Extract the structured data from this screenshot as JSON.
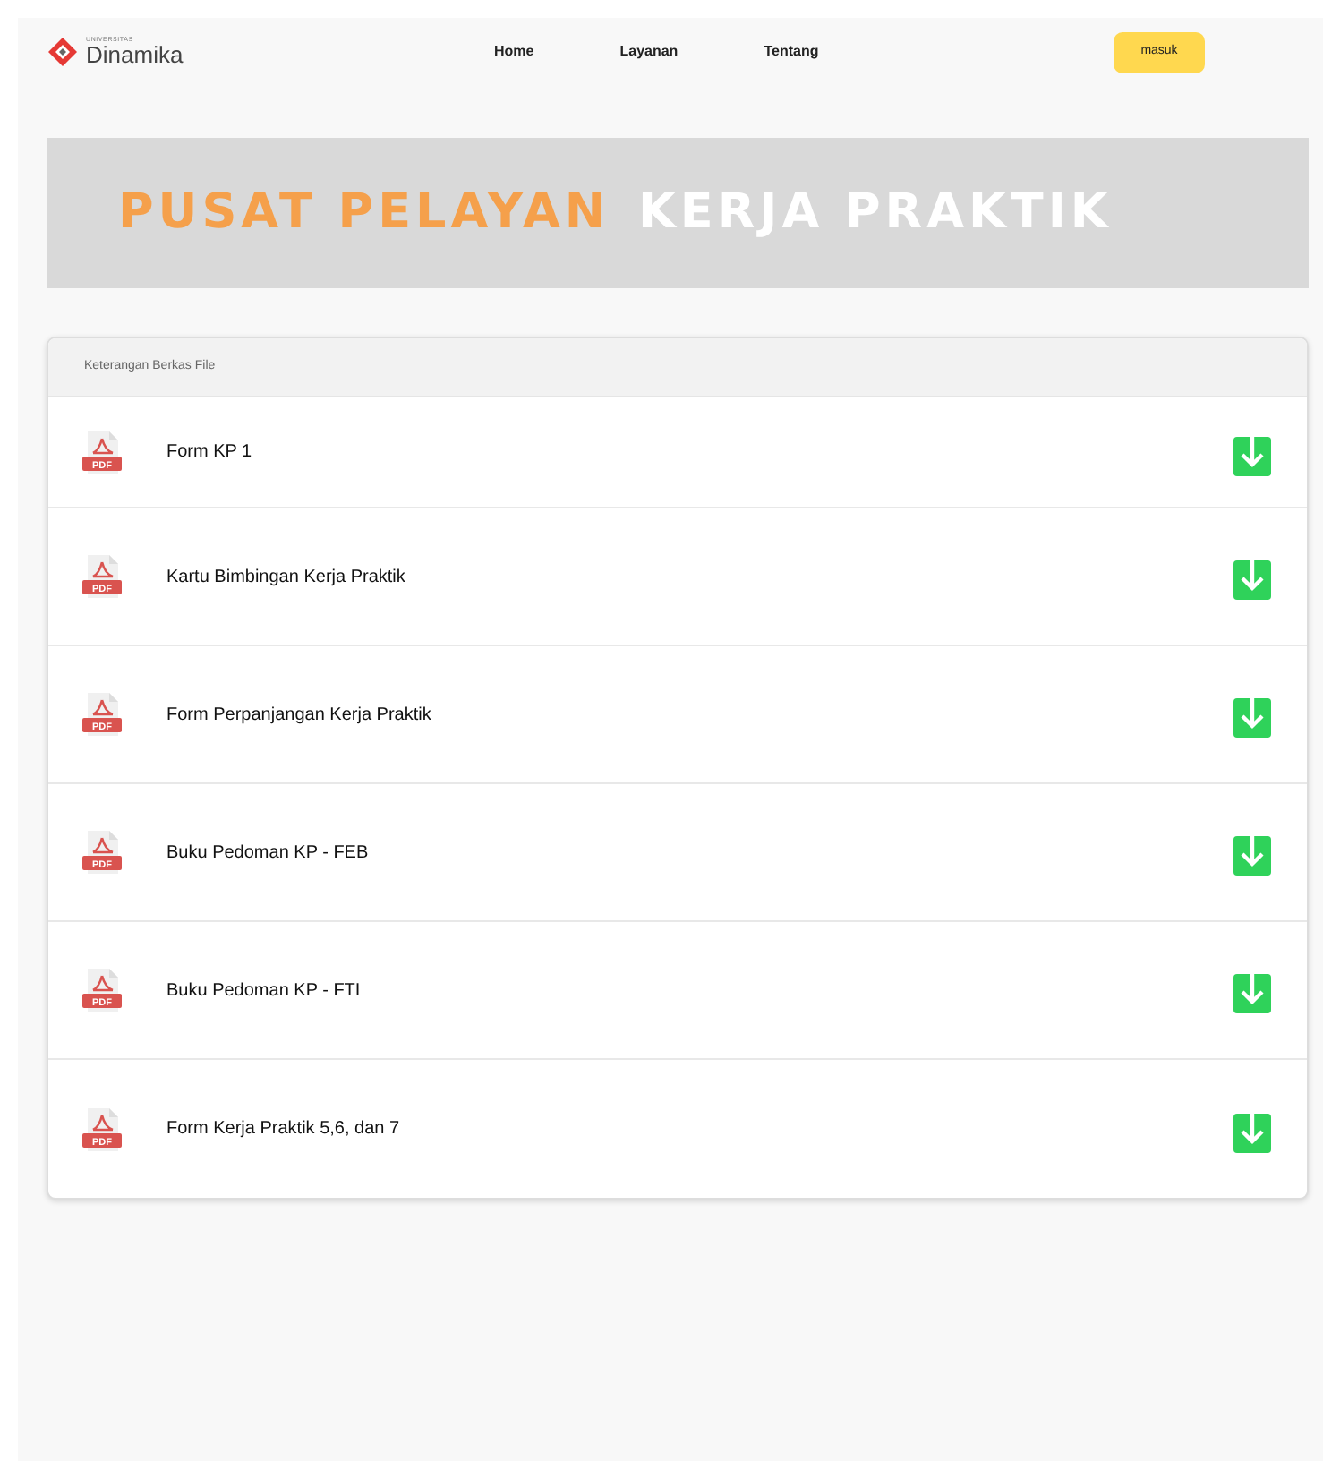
{
  "navbar": {
    "logo": {
      "small_text": "UNIVERSITAS",
      "name": "Dinamika"
    },
    "links": [
      {
        "label": "Home"
      },
      {
        "label": "Layanan"
      },
      {
        "label": "Tentang"
      }
    ],
    "login_button": "masuk"
  },
  "banner": {
    "heading": [
      {
        "text": "PUSAT PELAYAN",
        "color": "#f5a04b"
      },
      {
        "text": "KERJA PRAKTIK",
        "color": "#ffffff"
      }
    ]
  },
  "files": {
    "header": "Keterangan Berkas File",
    "items": [
      {
        "name": "Form KP 1",
        "file_type": "PDF"
      },
      {
        "name": "Kartu Bimbingan Kerja Praktik",
        "file_type": "PDF"
      },
      {
        "name": "Form Perpanjangan Kerja Praktik",
        "file_type": "PDF"
      },
      {
        "name": "Buku Pedoman KP - FEB",
        "file_type": "PDF"
      },
      {
        "name": "Buku Pedoman KP - FTI",
        "file_type": "PDF"
      },
      {
        "name": "Form Kerja Praktik 5,6, dan 7",
        "file_type": "PDF"
      }
    ]
  }
}
